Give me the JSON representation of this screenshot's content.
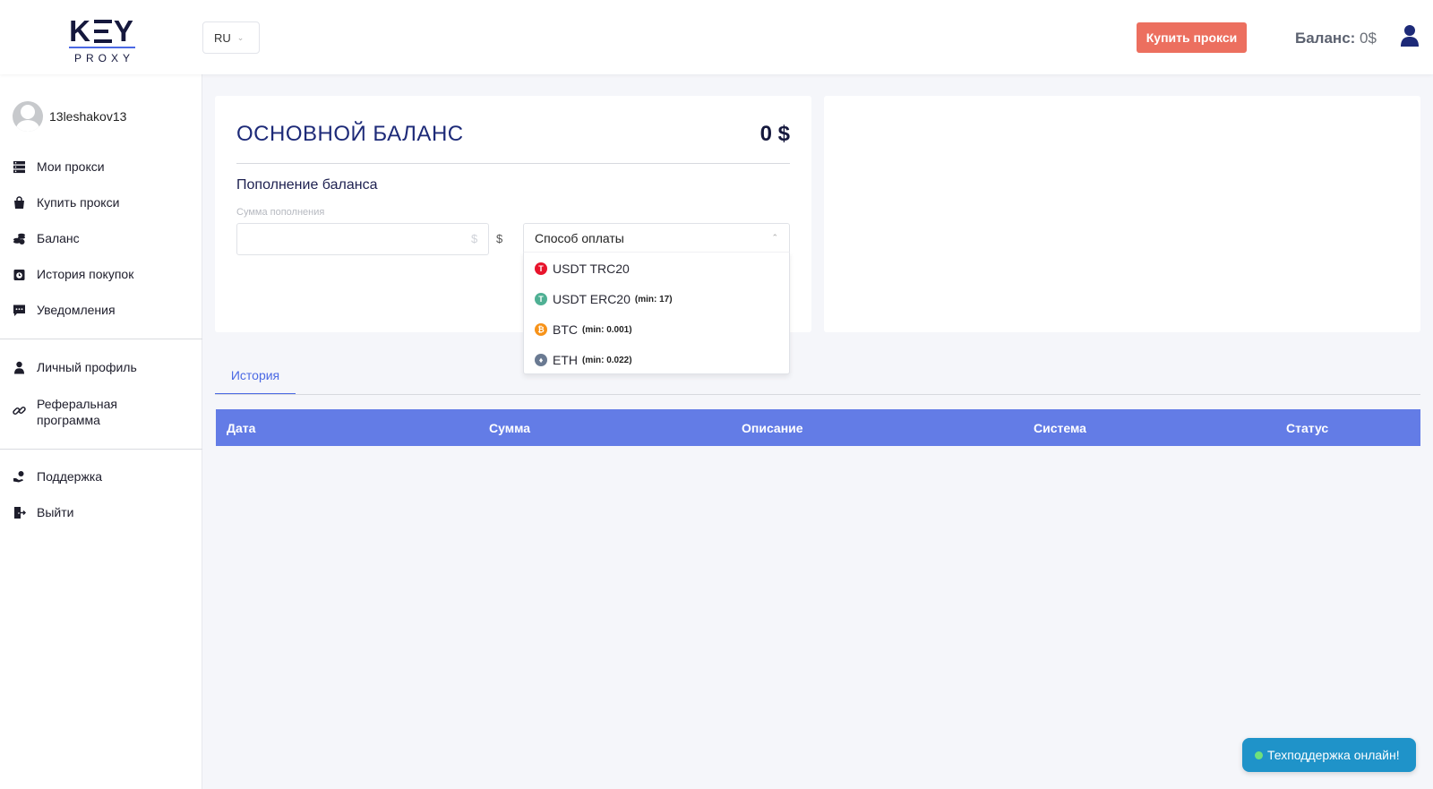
{
  "header": {
    "logo_top": "KEY",
    "logo_bottom": "PROXY",
    "language": "RU",
    "buy_button": "Купить прокси",
    "balance_label": "Баланс:",
    "balance_value": "0$"
  },
  "sidebar": {
    "username": "13leshakov13",
    "items": [
      {
        "label": "Мои прокси",
        "icon": "server-icon"
      },
      {
        "label": "Купить прокси",
        "icon": "shopping-bag-icon"
      },
      {
        "label": "Баланс",
        "icon": "coins-icon"
      },
      {
        "label": "История покупок",
        "icon": "history-icon"
      },
      {
        "label": "Уведомления",
        "icon": "chat-icon"
      },
      {
        "label": "Личный профиль",
        "icon": "user-icon"
      },
      {
        "label": "Реферальная программа",
        "icon": "link-icon"
      },
      {
        "label": "Поддержка",
        "icon": "hand-support-icon"
      },
      {
        "label": "Выйти",
        "icon": "logout-icon"
      }
    ]
  },
  "balance": {
    "title": "ОСНОВНОЙ БАЛАНС",
    "amount": "0 $",
    "topup_title": "Пополнение баланса",
    "sum_label": "Сумма пополнения",
    "sum_value": "",
    "sum_placeholder": "$",
    "currency": "$"
  },
  "payment": {
    "placeholder": "Способ оплаты",
    "options": [
      {
        "label": "USDT TRC20",
        "min": "",
        "color": "#e8142c",
        "icon": "T"
      },
      {
        "label": "USDT ERC20",
        "min": "(min: 17)",
        "color": "#4fb094",
        "icon": "T"
      },
      {
        "label": "BTC",
        "min": "(min: 0.001)",
        "color": "#f7931a",
        "icon": "₿"
      },
      {
        "label": "ETH",
        "min": "(min: 0.022)",
        "color": "#6a7a92",
        "icon": "♦"
      }
    ]
  },
  "history": {
    "tab": "История",
    "columns": [
      "Дата",
      "Сумма",
      "Описание",
      "Система",
      "Статус"
    ]
  },
  "support_widget": "Техподдержка онлайн!",
  "colors": {
    "accent": "#4b69e4",
    "table_header": "#637ce6",
    "buy_button": "#ec6f5f",
    "support": "#1f93c9"
  }
}
